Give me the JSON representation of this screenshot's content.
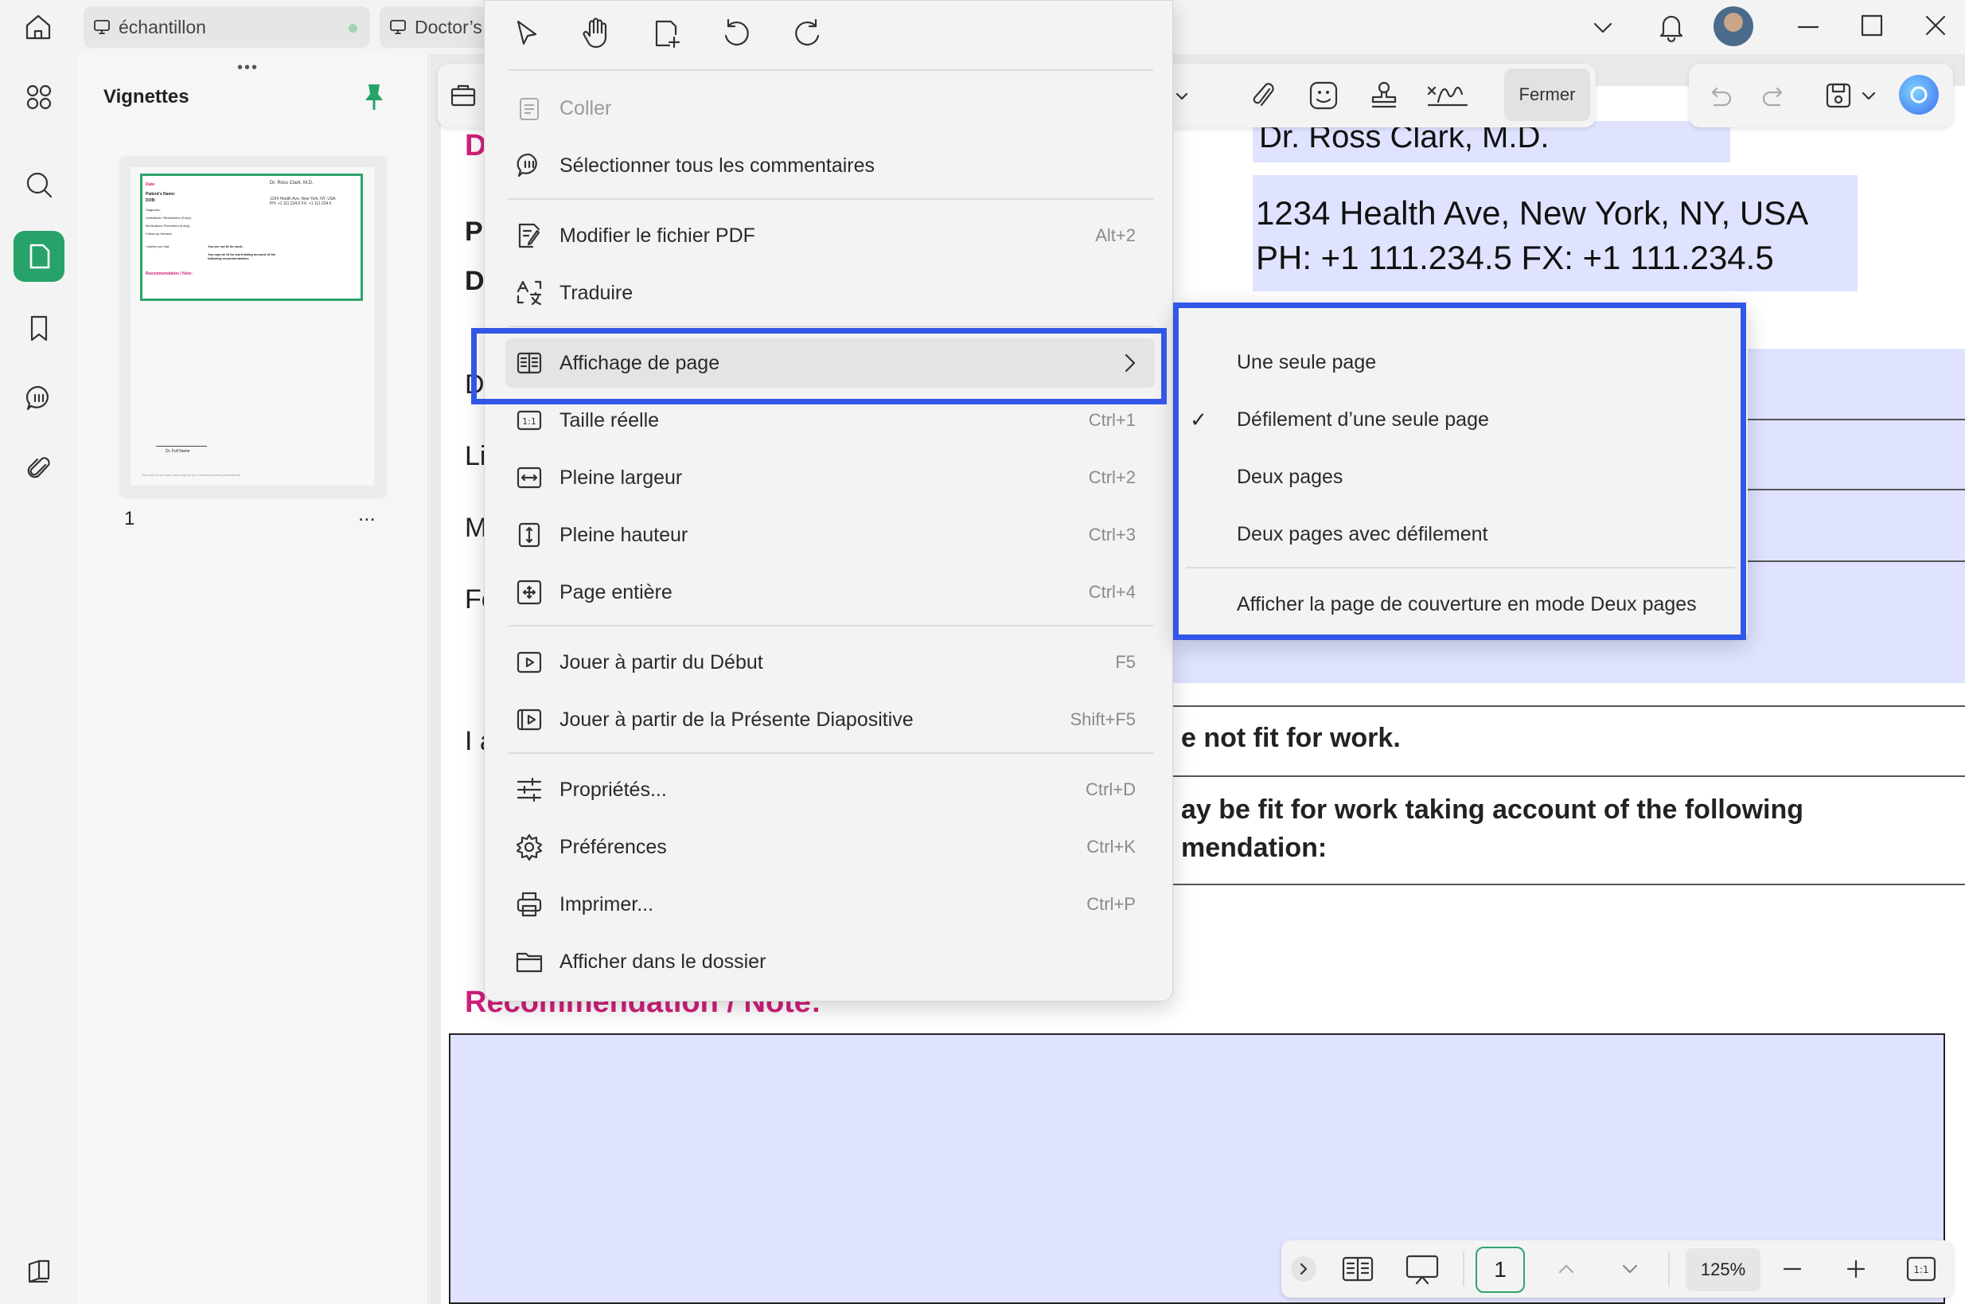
{
  "titlebar": {
    "tabs": [
      {
        "label": "échantillon"
      },
      {
        "label": "Doctor’s"
      }
    ]
  },
  "thumbs": {
    "title": "Vignettes",
    "page_number": "1",
    "more": "...",
    "mini": {
      "doctor": "Dr. Ross Clark, M.D.",
      "address": "1234 Health Ave, New York, NY, USA",
      "phone": "PH: +1 111.234.5 FX: +1 111.234.5",
      "fields": [
        "Date:",
        "Patient's Name:",
        "DOB:",
        "Diagnosis:",
        "Limitations / Restrictions (if any):",
        "Medications Prescribed (if any):",
        "Follow-up Needed:"
      ],
      "advise": "I advise you that:",
      "opt1": "You are not fit for work.",
      "opt2": "You may be fit for work taking account of the following recommendation:",
      "reco": "Recommendation / Note:",
      "sig": "Dr. Full Name",
      "footer": "This note is not valid unless signed by a licensed medical professional."
    }
  },
  "toolbar": {
    "fermer": "Fermer"
  },
  "document": {
    "doctor": "Dr. Ross Clark, M.D.",
    "address": "1234 Health Ave, New York, NY, USA",
    "phone": "PH: +1 111.234.5 FX: +1 111.234.5",
    "left_letters": [
      "D",
      "P",
      "D",
      "D",
      "Li",
      "M",
      "Fo",
      "I a"
    ],
    "opt1_tail": "e not fit for work.",
    "opt2_line1": "ay be fit for work taking account of the following",
    "opt2_line2": "mendation:",
    "reco": "Recommendation / Note:"
  },
  "context_menu": {
    "items": [
      {
        "label": "Coller",
        "shortcut": ""
      },
      {
        "label": "Sélectionner tous les commentaires",
        "shortcut": ""
      },
      {
        "label": "Modifier le fichier PDF",
        "shortcut": "Alt+2"
      },
      {
        "label": "Traduire",
        "shortcut": ""
      },
      {
        "label": "Affichage de page",
        "shortcut": ""
      },
      {
        "label": "Taille réelle",
        "shortcut": "Ctrl+1"
      },
      {
        "label": "Pleine largeur",
        "shortcut": "Ctrl+2"
      },
      {
        "label": "Pleine hauteur",
        "shortcut": "Ctrl+3"
      },
      {
        "label": "Page entière",
        "shortcut": "Ctrl+4"
      },
      {
        "label": "Jouer à partir du Début",
        "shortcut": "F5"
      },
      {
        "label": "Jouer à partir de la Présente Diapositive",
        "shortcut": "Shift+F5"
      },
      {
        "label": "Propriétés...",
        "shortcut": "Ctrl+D"
      },
      {
        "label": "Préférences",
        "shortcut": "Ctrl+K"
      },
      {
        "label": "Imprimer...",
        "shortcut": "Ctrl+P"
      },
      {
        "label": "Afficher dans le dossier",
        "shortcut": ""
      }
    ]
  },
  "submenu": {
    "checkmark": "✓",
    "items": [
      {
        "label": "Une seule page"
      },
      {
        "label": "Défilement d’une seule page"
      },
      {
        "label": "Deux pages"
      },
      {
        "label": "Deux pages avec défilement"
      },
      {
        "label": "Afficher la page de couverture en mode Deux pages"
      }
    ]
  },
  "bottombar": {
    "page": "1",
    "zoom": "125%"
  },
  "colors": {
    "accent": "#27a36a",
    "highlight": "#3257e6",
    "field_fill": "#dfe3ff",
    "magenta": "#d21f7a"
  }
}
